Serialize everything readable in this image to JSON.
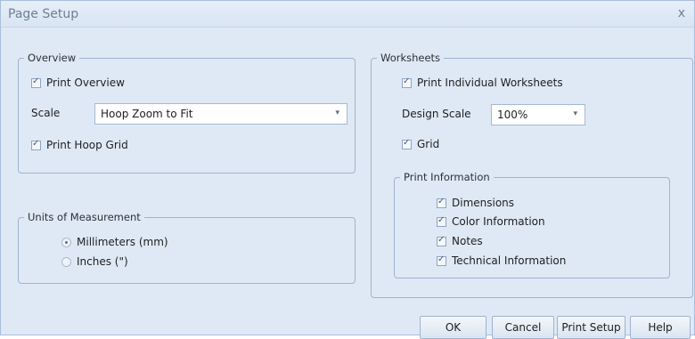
{
  "window": {
    "title": "Page Setup",
    "close_glyph": "x"
  },
  "overview": {
    "legend": "Overview",
    "print_overview": {
      "label": "Print Overview",
      "checked": true
    },
    "scale_label": "Scale",
    "scale_value": "Hoop Zoom to Fit",
    "print_hoop_grid": {
      "label": "Print Hoop Grid",
      "checked": true
    }
  },
  "units": {
    "legend": "Units of Measurement",
    "options": [
      {
        "label": "Millimeters (mm)",
        "selected": true
      },
      {
        "label": "Inches (\")",
        "selected": false
      }
    ]
  },
  "worksheets": {
    "legend": "Worksheets",
    "print_individual": {
      "label": "Print Individual Worksheets",
      "checked": true
    },
    "design_scale_label": "Design Scale",
    "design_scale_value": "100%",
    "grid": {
      "label": "Grid",
      "checked": true
    },
    "print_information": {
      "legend": "Print Information",
      "items": [
        {
          "label": "Dimensions",
          "checked": true
        },
        {
          "label": "Color Information",
          "checked": true
        },
        {
          "label": "Notes",
          "checked": true
        },
        {
          "label": "Technical Information",
          "checked": true
        }
      ]
    }
  },
  "buttons": {
    "ok": "OK",
    "cancel": "Cancel",
    "print_setup": "Print Setup",
    "help": "Help"
  },
  "icons": {
    "checkbox": "check-icon",
    "dropdown": "chevron-down-icon",
    "close": "close-icon"
  },
  "colors": {
    "dialog_bg": "#dfe9f5",
    "border": "#9fb3cf",
    "title_text": "#6f7f92"
  }
}
